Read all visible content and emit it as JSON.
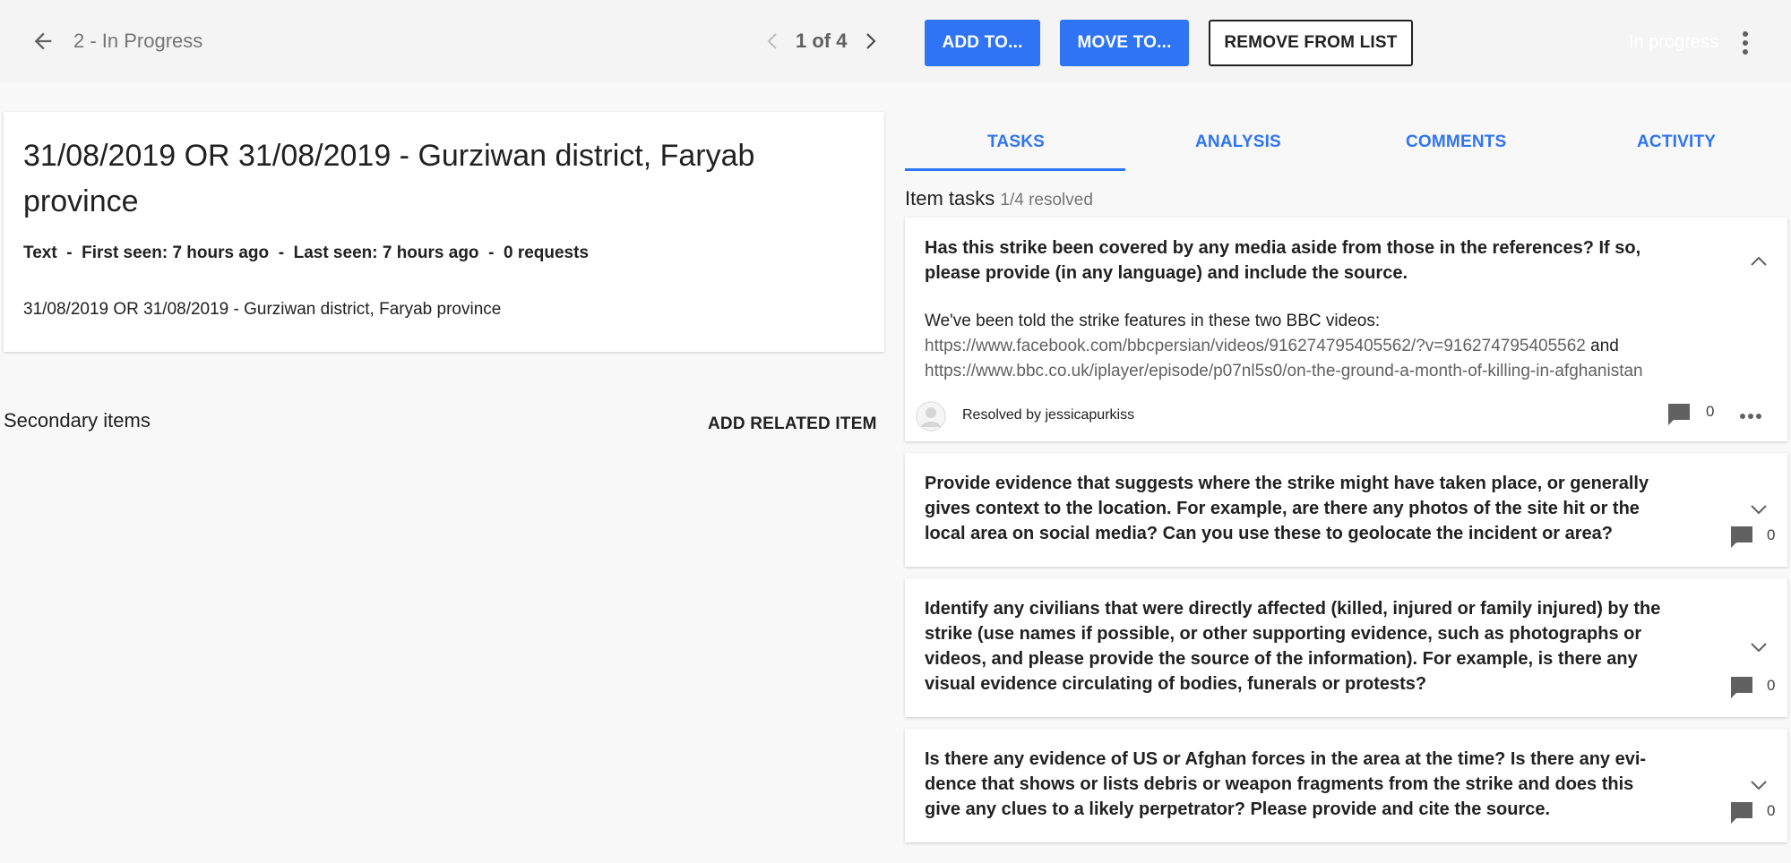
{
  "header": {
    "list_name": "2 - In Progress",
    "pager": "1 of 4",
    "add_to_label": "ADD TO...",
    "move_to_label": "MOVE TO...",
    "remove_label": "REMOVE FROM LIST",
    "status_text": "In progress"
  },
  "item": {
    "title": "31/08/2019 OR 31/08/2019 - Gurziwan district, Faryab province",
    "meta": "Text  -  First seen: 7 hours ago  -  Last seen: 7 hours ago  -  0 requests",
    "description": "31/08/2019 OR 31/08/2019 - Gurziwan district, Faryab province"
  },
  "secondary": {
    "label": "Secondary items",
    "add_related_label": "ADD RELATED ITEM"
  },
  "tabs": [
    {
      "label": "TASKS"
    },
    {
      "label": "ANALYSIS"
    },
    {
      "label": "COMMENTS"
    },
    {
      "label": "ACTIVITY"
    }
  ],
  "tasks_panel": {
    "heading": "Item tasks",
    "resolved_count": "1/4 resolved"
  },
  "tasks": [
    {
      "question": "Has this strike been covered by any media aside from those in the references? If so, please provide (in any language) and include the source.",
      "answer_intro": "We've been told the strike features in these two BBC videos:",
      "answer_link_1": "https://www.facebook.com/bbcpersian/videos/916274795405562/?v=916274795405562",
      "answer_and": " and ",
      "answer_link_2": "https://www.bbc.co.uk/iplayer/episode/p07nl5s0/on-the-ground-a-month-of-killing-in-afghanistan",
      "resolved_by": "Resolved by jessicapurkiss",
      "comments": "0"
    },
    {
      "question": "Provide evidence that suggests where the strike might have taken place, or generally gives context to the location. For example, are there any photos of the site hit or the local area on social media? Can you use these to geolocate the incident or area?",
      "comments": "0"
    },
    {
      "question": "Identify any civilians that were directly affected (killed, injured or family injured) by the strike (use names if possible, or other supporting evidence, such as photographs or videos, and please provide the source of the information). For example, is there any visual evidence circulating of bodies, funerals or protests?",
      "comments": "0"
    },
    {
      "question": "Is there any evidence of US or Afghan forces in the area at the time? Is there any evi- dence that shows or lists debris or weapon fragments from the strike and does this give any clues to a likely perpetrator? Please provide and cite the source.",
      "comments": "0"
    }
  ],
  "colors": {
    "accent": "#2f74f5",
    "background": "#f8f8f8",
    "topbar": "#f4f4f4"
  }
}
